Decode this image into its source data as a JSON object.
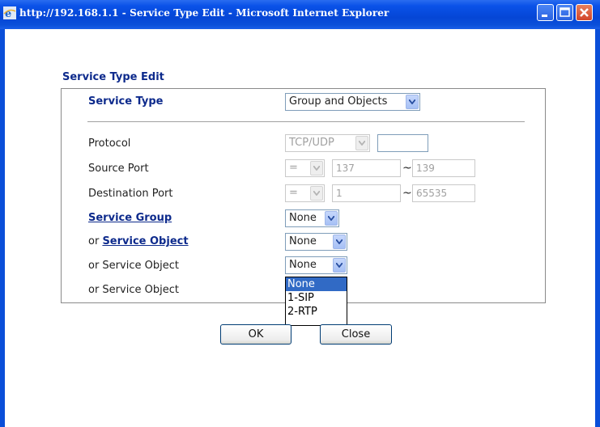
{
  "window": {
    "title": "http://192.168.1.1 - Service Type Edit - Microsoft Internet Explorer"
  },
  "form": {
    "section_title": "Service Type Edit",
    "service_type": {
      "label": "Service Type",
      "value": "Group and Objects"
    },
    "protocol": {
      "label": "Protocol",
      "value": "TCP/UDP",
      "number": ""
    },
    "source_port": {
      "label": "Source Port",
      "operator": "=",
      "start": "137",
      "tilde": "~",
      "end": "139"
    },
    "destination_port": {
      "label": "Destination Port",
      "operator": "=",
      "start": "1",
      "tilde": "~",
      "end": "65535"
    },
    "service_group": {
      "label": "Service Group",
      "value": "None"
    },
    "service_object_1": {
      "prefix": "or ",
      "label": "Service Object",
      "value": "None"
    },
    "service_object_2": {
      "label": "or Service Object",
      "value": "None"
    },
    "service_object_3": {
      "label": "or Service Object"
    },
    "dropdown_options": [
      "None",
      "1-SIP",
      "2-RTP"
    ],
    "dropdown_selected": "None"
  },
  "buttons": {
    "ok": "OK",
    "close": "Close"
  },
  "colors": {
    "titlebar": "#0a4fd9",
    "label_blue": "#0d2a8c",
    "selection": "#316ac5"
  }
}
